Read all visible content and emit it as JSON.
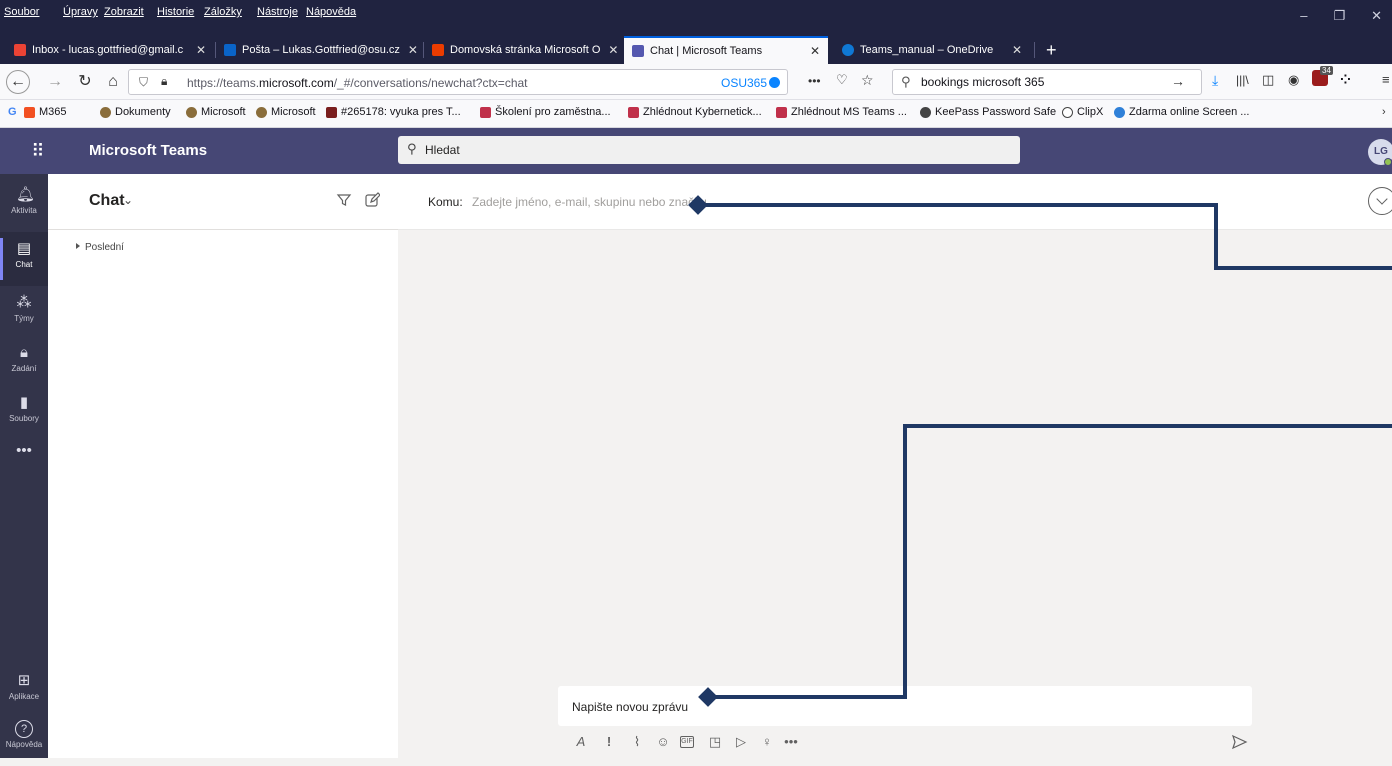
{
  "menubar": {
    "items": [
      "Soubor",
      "Úpravy",
      "Zobrazit",
      "Historie",
      "Záložky",
      "Nástroje",
      "Nápověda"
    ]
  },
  "tabs": [
    {
      "label": "Inbox - lucas.gottfried@gmail.c",
      "icon": "gmail-icon",
      "color": "#ea4335"
    },
    {
      "label": "Pošta – Lukas.Gottfried@osu.cz",
      "icon": "outlook-icon",
      "color": "#0a64c8"
    },
    {
      "label": "Domovská stránka Microsoft O",
      "icon": "office-icon",
      "color": "#eb3c00"
    },
    {
      "label": "Chat | Microsoft Teams",
      "icon": "teams-icon",
      "color": "#5558af"
    },
    {
      "label": "Teams_manual – OneDrive",
      "icon": "onedrive-icon",
      "color": "#0f78d4"
    }
  ],
  "navbar": {
    "url_prefix": "https://teams.",
    "url_domain": "microsoft.com",
    "url_path": "/_#/conversations/newchat?ctx=chat",
    "container_label": "OSU365",
    "search_value": "bookings microsoft 365",
    "ublock_badge": "34"
  },
  "bookmarks": [
    {
      "label": "M365",
      "color": "#f25022"
    },
    {
      "label": "Dokumenty",
      "color": "#8a6d3b"
    },
    {
      "label": "Microsoft",
      "color": "#8a6d3b"
    },
    {
      "label": "Microsoft",
      "color": "#8a6d3b"
    },
    {
      "label": "#265178: vyuka pres T...",
      "color": "#7a1e1e"
    },
    {
      "label": "Školení pro zaměstna...",
      "color": "#c0304a"
    },
    {
      "label": "Zhlédnout Kybernetick...",
      "color": "#c0304a"
    },
    {
      "label": "Zhlédnout MS Teams ...",
      "color": "#c0304a"
    },
    {
      "label": "KeePass Password Safe",
      "color": "#444"
    },
    {
      "label": "ClipX",
      "color": "#444"
    },
    {
      "label": "Zdarma online Screen ...",
      "color": "#2f80d8"
    }
  ],
  "teams": {
    "app_title": "Microsoft Teams",
    "search_placeholder": "Hledat",
    "avatar_initials": "LG",
    "accent": "#464775",
    "rail": [
      {
        "label": "Aktivita",
        "icon": "bell-icon"
      },
      {
        "label": "Chat",
        "icon": "chat-icon"
      },
      {
        "label": "Týmy",
        "icon": "teams-people-icon"
      },
      {
        "label": "Zadání",
        "icon": "assignments-icon"
      },
      {
        "label": "Soubory",
        "icon": "files-icon"
      },
      {
        "label": "",
        "icon": "more-icon"
      },
      {
        "label": "Aplikace",
        "icon": "apps-icon"
      },
      {
        "label": "Nápověda",
        "icon": "help-icon"
      }
    ],
    "chat_list": {
      "title": "Chat",
      "section_label": "Poslední"
    },
    "new_chat": {
      "to_label": "Komu:",
      "to_placeholder": "Zadejte jméno, e-mail, skupinu nebo značku",
      "compose_placeholder": "Napište novou zprávu"
    }
  }
}
